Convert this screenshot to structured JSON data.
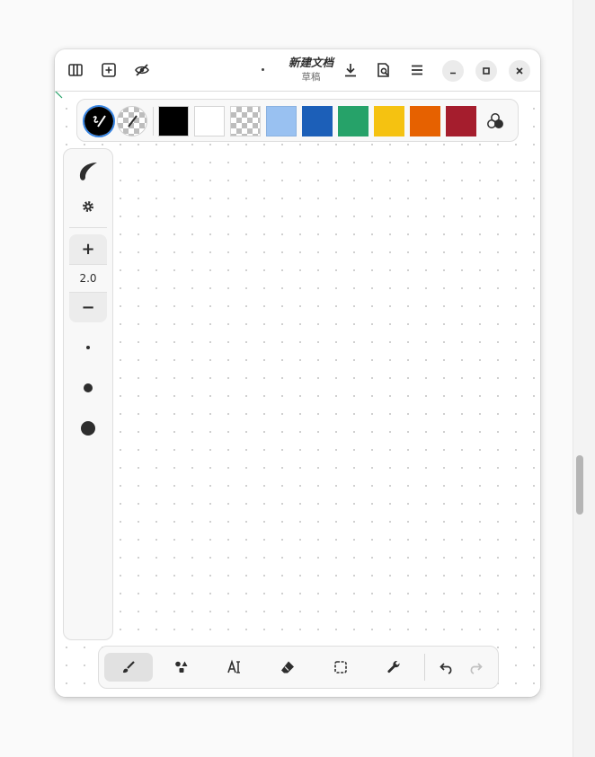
{
  "window": {
    "title": "新建文档",
    "subtitle": "草稿",
    "modified_indicator": "•"
  },
  "header": {
    "left_buttons": [
      "sidebar-toggle-icon",
      "add-page-icon",
      "eye-off-icon"
    ],
    "right_buttons": [
      "download-icon",
      "document-search-icon",
      "menu-icon"
    ],
    "window_controls": [
      "minimize-icon",
      "maximize-icon",
      "close-icon"
    ]
  },
  "palette": {
    "colors": [
      "#000000",
      "#ffffff",
      "transparent",
      "#99c1f1",
      "#1c5fb8",
      "#26a269",
      "#f5c211",
      "#e66100",
      "#a51d2d"
    ],
    "selected_index": 0,
    "color_mixer_icon": "color-mixer-icon"
  },
  "sidebar": {
    "pen_style_icon": "brush-stroke-icon",
    "settings_icon": "gear-icon",
    "increase_label": "+",
    "size_value": "2.0",
    "decrease_label": "−",
    "size_presets": [
      "small",
      "medium",
      "large"
    ]
  },
  "toolbar": {
    "tools": [
      "brush-icon",
      "shapes-icon",
      "text-icon",
      "eraser-icon",
      "selector-icon",
      "wrench-icon"
    ],
    "active_index": 0,
    "undo_icon": "undo-icon",
    "redo_icon": "redo-icon",
    "redo_enabled": false
  },
  "accent_color": "#3584e4"
}
